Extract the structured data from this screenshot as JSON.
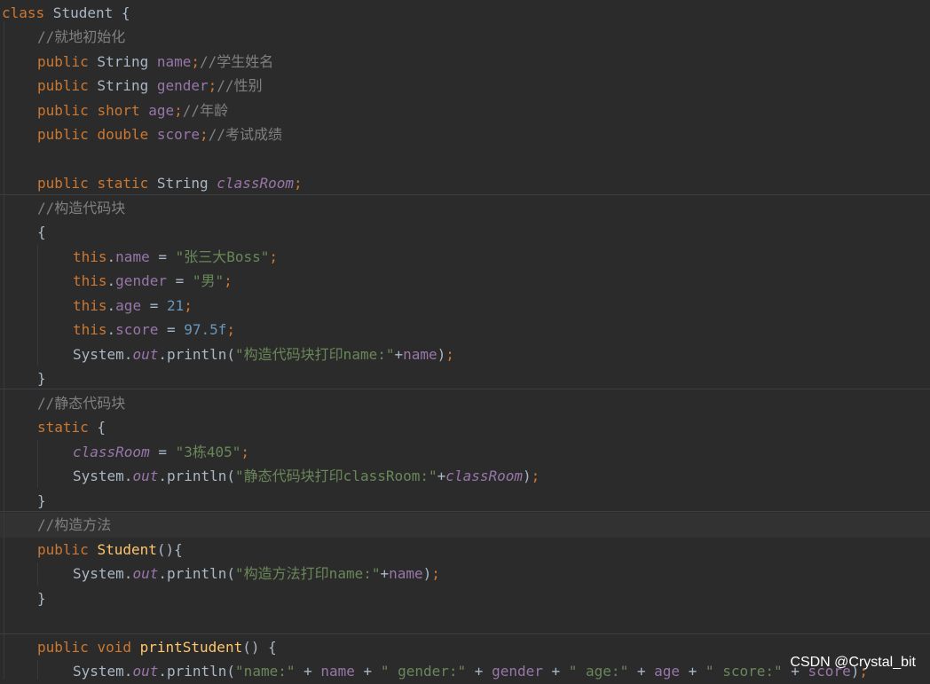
{
  "colors": {
    "background": "#2b2b2b",
    "keyword": "#cc7832",
    "field": "#9876aa",
    "string": "#6a8759",
    "number": "#6897bb",
    "comment": "#808080",
    "method": "#ffc66d",
    "text": "#a9b7c6"
  },
  "watermark": "CSDN @Crystal_bit",
  "lines": [
    {
      "indent": 0,
      "tokens": [
        [
          "kw",
          "class"
        ],
        [
          "p",
          " Student {"
        ]
      ]
    },
    {
      "indent": 1,
      "tokens": [
        [
          "cmt",
          "//就地初始化"
        ]
      ]
    },
    {
      "indent": 1,
      "tokens": [
        [
          "kw",
          "public"
        ],
        [
          "p",
          " String "
        ],
        [
          "field",
          "name"
        ],
        [
          "kw",
          ";"
        ],
        [
          "cmt",
          "//学生姓名"
        ]
      ]
    },
    {
      "indent": 1,
      "tokens": [
        [
          "kw",
          "public"
        ],
        [
          "p",
          " String "
        ],
        [
          "field",
          "gender"
        ],
        [
          "kw",
          ";"
        ],
        [
          "cmt",
          "//性别"
        ]
      ]
    },
    {
      "indent": 1,
      "tokens": [
        [
          "kw",
          "public"
        ],
        [
          "p",
          " "
        ],
        [
          "kw",
          "short"
        ],
        [
          "p",
          " "
        ],
        [
          "field",
          "age"
        ],
        [
          "kw",
          ";"
        ],
        [
          "cmt",
          "//年龄"
        ]
      ]
    },
    {
      "indent": 1,
      "tokens": [
        [
          "kw",
          "public"
        ],
        [
          "p",
          " "
        ],
        [
          "kw",
          "double"
        ],
        [
          "p",
          " "
        ],
        [
          "field",
          "score"
        ],
        [
          "kw",
          ";"
        ],
        [
          "cmt",
          "//考试成绩"
        ]
      ]
    },
    {
      "indent": 0,
      "tokens": []
    },
    {
      "indent": 1,
      "tokens": [
        [
          "kw",
          "public"
        ],
        [
          "p",
          " "
        ],
        [
          "kw",
          "static"
        ],
        [
          "p",
          " String "
        ],
        [
          "sfield",
          "classRoom"
        ],
        [
          "kw",
          ";"
        ]
      ]
    },
    {
      "indent": 1,
      "tokens": [
        [
          "cmt",
          "//构造代码块"
        ]
      ]
    },
    {
      "indent": 1,
      "tokens": [
        [
          "p",
          "{"
        ]
      ]
    },
    {
      "indent": 2,
      "tokens": [
        [
          "kw",
          "this"
        ],
        [
          "p",
          "."
        ],
        [
          "field",
          "name"
        ],
        [
          "p",
          " = "
        ],
        [
          "str",
          "\"张三大Boss\""
        ],
        [
          "kw",
          ";"
        ]
      ]
    },
    {
      "indent": 2,
      "tokens": [
        [
          "kw",
          "this"
        ],
        [
          "p",
          "."
        ],
        [
          "field",
          "gender"
        ],
        [
          "p",
          " = "
        ],
        [
          "str",
          "\"男\""
        ],
        [
          "kw",
          ";"
        ]
      ]
    },
    {
      "indent": 2,
      "tokens": [
        [
          "kw",
          "this"
        ],
        [
          "p",
          "."
        ],
        [
          "field",
          "age"
        ],
        [
          "p",
          " = "
        ],
        [
          "num",
          "21"
        ],
        [
          "kw",
          ";"
        ]
      ]
    },
    {
      "indent": 2,
      "tokens": [
        [
          "kw",
          "this"
        ],
        [
          "p",
          "."
        ],
        [
          "field",
          "score"
        ],
        [
          "p",
          " = "
        ],
        [
          "num",
          "97.5f"
        ],
        [
          "kw",
          ";"
        ]
      ]
    },
    {
      "indent": 2,
      "tokens": [
        [
          "p",
          "System."
        ],
        [
          "sfield",
          "out"
        ],
        [
          "p",
          ".println("
        ],
        [
          "str",
          "\"构造代码块打印name:\""
        ],
        [
          "p",
          "+"
        ],
        [
          "field",
          "name"
        ],
        [
          "p",
          ")"
        ],
        [
          "kw",
          ";"
        ]
      ]
    },
    {
      "indent": 1,
      "tokens": [
        [
          "p",
          "}"
        ]
      ]
    },
    {
      "indent": 1,
      "tokens": [
        [
          "cmt",
          "//静态代码块"
        ]
      ]
    },
    {
      "indent": 1,
      "tokens": [
        [
          "kw",
          "static"
        ],
        [
          "p",
          " {"
        ]
      ]
    },
    {
      "indent": 2,
      "tokens": [
        [
          "sfield",
          "classRoom"
        ],
        [
          "p",
          " = "
        ],
        [
          "str",
          "\"3栋405\""
        ],
        [
          "kw",
          ";"
        ]
      ]
    },
    {
      "indent": 2,
      "tokens": [
        [
          "p",
          "System."
        ],
        [
          "sfield",
          "out"
        ],
        [
          "p",
          ".println("
        ],
        [
          "str",
          "\"静态代码块打印classRoom:\""
        ],
        [
          "p",
          "+"
        ],
        [
          "sfield",
          "classRoom"
        ],
        [
          "p",
          ")"
        ],
        [
          "kw",
          ";"
        ]
      ]
    },
    {
      "indent": 1,
      "tokens": [
        [
          "p",
          "}"
        ]
      ]
    },
    {
      "indent": 1,
      "tokens": [
        [
          "cmt",
          "//构造方法"
        ]
      ],
      "current": true
    },
    {
      "indent": 1,
      "tokens": [
        [
          "kw",
          "public"
        ],
        [
          "p",
          " "
        ],
        [
          "method",
          "Student"
        ],
        [
          "p",
          "(){"
        ]
      ]
    },
    {
      "indent": 2,
      "tokens": [
        [
          "p",
          "System."
        ],
        [
          "sfield",
          "out"
        ],
        [
          "p",
          ".println("
        ],
        [
          "str",
          "\"构造方法打印name:\""
        ],
        [
          "p",
          "+"
        ],
        [
          "field",
          "name"
        ],
        [
          "p",
          ")"
        ],
        [
          "kw",
          ";"
        ]
      ]
    },
    {
      "indent": 1,
      "tokens": [
        [
          "p",
          "}"
        ]
      ]
    },
    {
      "indent": 0,
      "tokens": []
    },
    {
      "indent": 1,
      "tokens": [
        [
          "kw",
          "public"
        ],
        [
          "p",
          " "
        ],
        [
          "kw",
          "void"
        ],
        [
          "p",
          " "
        ],
        [
          "method",
          "printStudent"
        ],
        [
          "p",
          "() {"
        ]
      ]
    },
    {
      "indent": 2,
      "tokens": [
        [
          "p",
          "System."
        ],
        [
          "sfield",
          "out"
        ],
        [
          "p",
          ".println("
        ],
        [
          "str",
          "\"name:\""
        ],
        [
          "p",
          " + "
        ],
        [
          "field",
          "name"
        ],
        [
          "p",
          " + "
        ],
        [
          "str",
          "\" gender:\""
        ],
        [
          "p",
          " + "
        ],
        [
          "field",
          "gender"
        ],
        [
          "p",
          " + "
        ],
        [
          "str",
          "\" age:\""
        ],
        [
          "p",
          " + "
        ],
        [
          "field",
          "age"
        ],
        [
          "p",
          " + "
        ],
        [
          "str",
          "\" score:\""
        ],
        [
          "p",
          " + "
        ],
        [
          "field",
          "score"
        ],
        [
          "p",
          ")"
        ],
        [
          "kw",
          ";"
        ]
      ]
    }
  ]
}
